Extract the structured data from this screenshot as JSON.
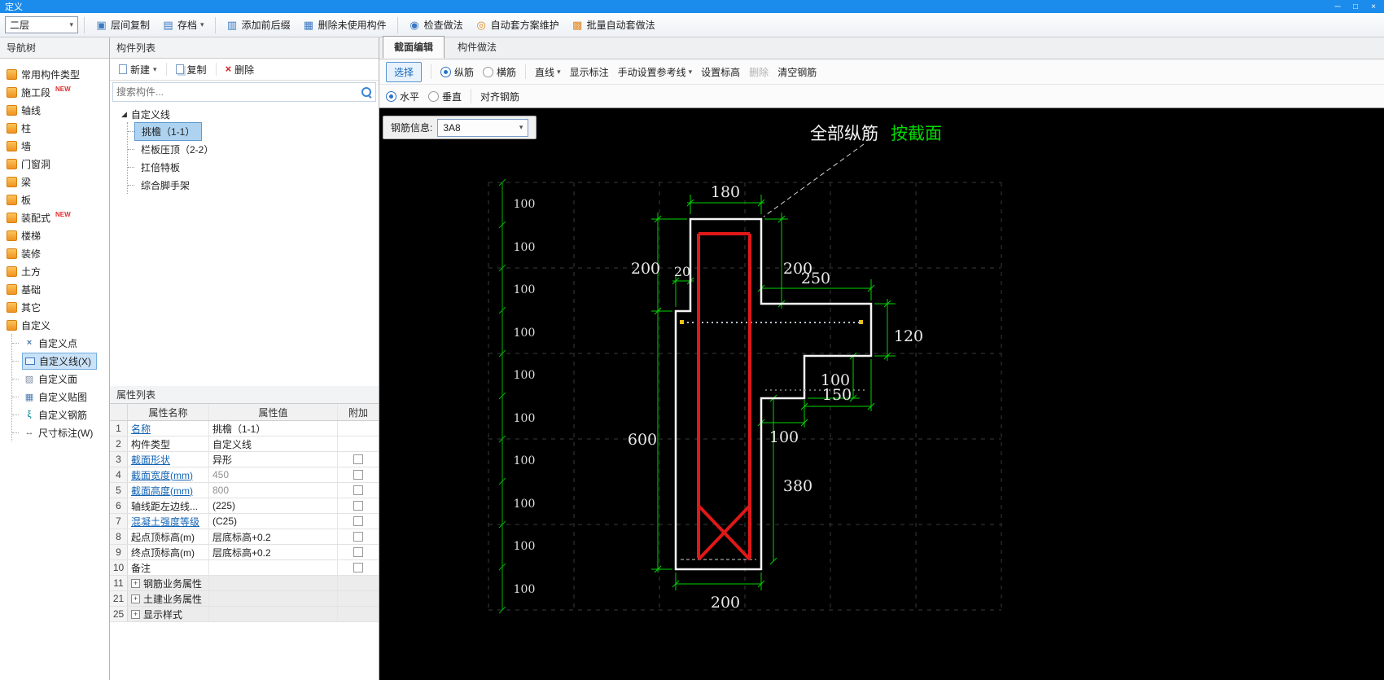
{
  "window": {
    "title": "定义",
    "min_glyph": "─",
    "max_glyph": "□",
    "close_glyph": "×"
  },
  "icons": {
    "caret": "▾"
  },
  "toolbar": {
    "floor": "二层",
    "buttons": [
      {
        "label": "层间复制"
      },
      {
        "label": "存档"
      },
      {
        "label": "添加前后缀"
      },
      {
        "label": "删除未使用构件"
      },
      {
        "label": "检查做法"
      },
      {
        "label": "自动套方案维护"
      },
      {
        "label": "批量自动套做法"
      }
    ]
  },
  "nav": {
    "header": "导航树",
    "items": [
      {
        "label": "常用构件类型",
        "badge": ""
      },
      {
        "label": "施工段",
        "badge": "NEW"
      },
      {
        "label": "轴线",
        "badge": ""
      },
      {
        "label": "柱",
        "badge": ""
      },
      {
        "label": "墙",
        "badge": ""
      },
      {
        "label": "门窗洞",
        "badge": ""
      },
      {
        "label": "梁",
        "badge": ""
      },
      {
        "label": "板",
        "badge": ""
      },
      {
        "label": "装配式",
        "badge": "NEW"
      },
      {
        "label": "楼梯",
        "badge": ""
      },
      {
        "label": "装修",
        "badge": ""
      },
      {
        "label": "土方",
        "badge": ""
      },
      {
        "label": "基础",
        "badge": ""
      },
      {
        "label": "其它",
        "badge": ""
      },
      {
        "label": "自定义",
        "badge": ""
      }
    ],
    "sub_items": [
      {
        "label": "自定义点",
        "icon_glyph": "×"
      },
      {
        "label": "自定义线(X)",
        "icon_glyph": ""
      },
      {
        "label": "自定义面",
        "icon_glyph": "▨"
      },
      {
        "label": "自定义贴图",
        "icon_glyph": "▦"
      },
      {
        "label": "自定义钢筋",
        "icon_glyph": "ξ"
      },
      {
        "label": "尺寸标注(W)",
        "icon_glyph": "↔"
      }
    ]
  },
  "components": {
    "header": "构件列表",
    "toolbar": {
      "new": "新建",
      "copy": "复制",
      "delete": "删除"
    },
    "search_placeholder": "搜索构件...",
    "expander_glyph": "◢",
    "group_label": "自定义线",
    "items": [
      "挑檐（1-1）",
      "栏板压顶（2-2）",
      "扛倍特板",
      "综合脚手架"
    ]
  },
  "properties": {
    "header": "属性列表",
    "columns": [
      "属性名称",
      "属性值",
      "附加"
    ],
    "expander_glyph": "+",
    "rows": [
      {
        "num": "1",
        "name": "名称",
        "value": "挑檐（1-1）"
      },
      {
        "num": "2",
        "name": "构件类型",
        "value": "自定义线"
      },
      {
        "num": "3",
        "name": "截面形状",
        "value": "异形"
      },
      {
        "num": "4",
        "name": "截面宽度(mm)",
        "value": "450"
      },
      {
        "num": "5",
        "name": "截面高度(mm)",
        "value": "800"
      },
      {
        "num": "6",
        "name": "轴线距左边线...",
        "value": "(225)"
      },
      {
        "num": "7",
        "name": "混凝土强度等级",
        "value": "(C25)"
      },
      {
        "num": "8",
        "name": "起点顶标高(m)",
        "value": "层底标高+0.2"
      },
      {
        "num": "9",
        "name": "终点顶标高(m)",
        "value": "层底标高+0.2"
      },
      {
        "num": "10",
        "name": "备注",
        "value": ""
      },
      {
        "num": "11",
        "name": "钢筋业务属性",
        "value": ""
      },
      {
        "num": "21",
        "name": "土建业务属性",
        "value": ""
      },
      {
        "num": "25",
        "name": "显示样式",
        "value": ""
      }
    ]
  },
  "editor": {
    "tabs": [
      {
        "label": "截面编辑"
      },
      {
        "label": "构件做法"
      }
    ],
    "toolbar": {
      "select": "选择",
      "longitudinal": "纵筋",
      "transverse": "横筋",
      "line": "直线",
      "show_labels": "显示标注",
      "manual_ref": "手动设置参考线",
      "set_elevation": "设置标高",
      "delete": "删除",
      "clear": "清空钢筋"
    },
    "toolbar2": {
      "horizontal": "水平",
      "vertical": "垂直",
      "align": "对齐钢筋"
    },
    "rebar_info": {
      "label": "钢筋信息:",
      "value": "3A8"
    },
    "annotation": {
      "white": "全部纵筋",
      "green": "按截面"
    },
    "dims": {
      "top": "180",
      "left_upper": "200",
      "offset": "20",
      "left_lower": "600",
      "right_upper": "200",
      "flange_width": "250",
      "flange_height": "120",
      "notch_height": "100",
      "notch_width": "150",
      "step_width": "100",
      "lower_right": "380",
      "bottom": "200",
      "grid_unit": "100"
    }
  }
}
